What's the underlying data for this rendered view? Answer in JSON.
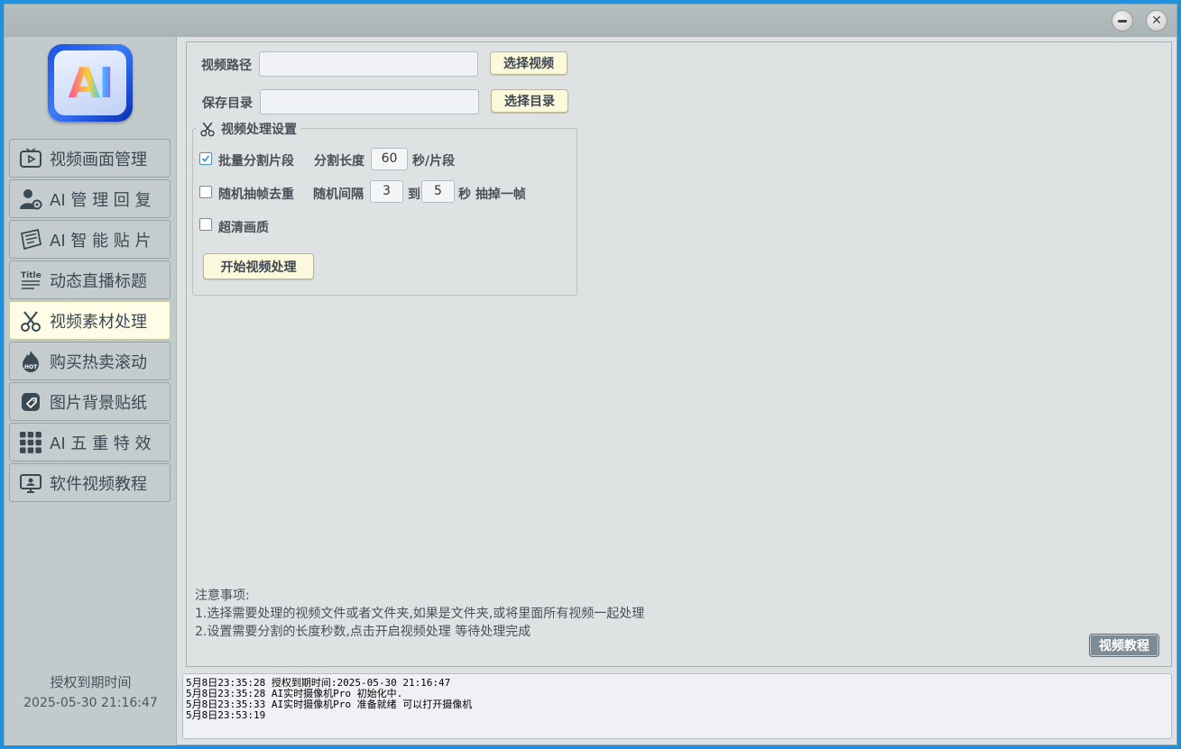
{
  "window": {
    "minimize_icon": "minimize-icon",
    "close_icon": "close-icon"
  },
  "sidebar": {
    "logo_text": "AI",
    "items": [
      {
        "label": "视频画面管理",
        "icon": "tv-play-icon",
        "spaced": false,
        "active": false
      },
      {
        "label": "AI 管 理 回 复",
        "icon": "user-gear-icon",
        "spaced": false,
        "active": false
      },
      {
        "label": "AI 智 能 贴 片",
        "icon": "sticker-icon",
        "spaced": false,
        "active": false
      },
      {
        "label": "动态直播标题",
        "icon": "title-icon",
        "spaced": false,
        "active": false
      },
      {
        "label": "视频素材处理",
        "icon": "scissors-icon",
        "spaced": false,
        "active": true
      },
      {
        "label": "购买热卖滚动",
        "icon": "hot-flame-icon",
        "spaced": false,
        "active": false
      },
      {
        "label": "图片背景贴纸",
        "icon": "tag-icon",
        "spaced": false,
        "active": false
      },
      {
        "label": "AI 五 重 特 效",
        "icon": "grid-icon",
        "spaced": false,
        "active": false
      },
      {
        "label": "软件视频教程",
        "icon": "monitor-icon",
        "spaced": false,
        "active": false
      }
    ],
    "expire_label": "授权到期时间",
    "expire_date": "2025-05-30 21:16:47"
  },
  "main": {
    "video_path_label": "视频路径",
    "video_path_value": "",
    "select_video_button": "选择视频",
    "save_dir_label": "保存目录",
    "save_dir_value": "",
    "select_dir_button": "选择目录",
    "settings_title": "视频处理设置",
    "batch_split": {
      "label": "批量分割片段",
      "checked": true,
      "length_label": "分割长度",
      "length_value": "60",
      "unit": "秒/片段"
    },
    "random_drop": {
      "label": "随机抽帧去重",
      "checked": false,
      "interval_label": "随机间隔",
      "from_value": "3",
      "to_label": "到",
      "to_value": "5",
      "unit": "秒 抽掉一帧"
    },
    "hd_quality": {
      "label": "超清画质",
      "checked": false
    },
    "start_button": "开始视频处理",
    "notes": {
      "title": "注意事项:",
      "line1": "1.选择需要处理的视频文件或者文件夹,如果是文件夹,或将里面所有视频一起处理",
      "line2": "2.设置需要分割的长度秒数,点击开启视频处理 等待处理完成"
    },
    "tutorial_button": "视频教程"
  },
  "log": {
    "lines": [
      "5月8日23:35:28 授权到期时间:2025-05-30 21:16:47",
      "5月8日23:35:28 AI实时摄像机Pro 初始化中.",
      "5月8日23:35:33 AI实时摄像机Pro 准备就绪 可以打开摄像机",
      "5月8日23:53:19"
    ]
  },
  "colors": {
    "frame": "#1e90e0",
    "active_nav": "#fffde6",
    "button_bg": "#fbf9dc",
    "tutorial_button_bg": "#7d8b95"
  }
}
